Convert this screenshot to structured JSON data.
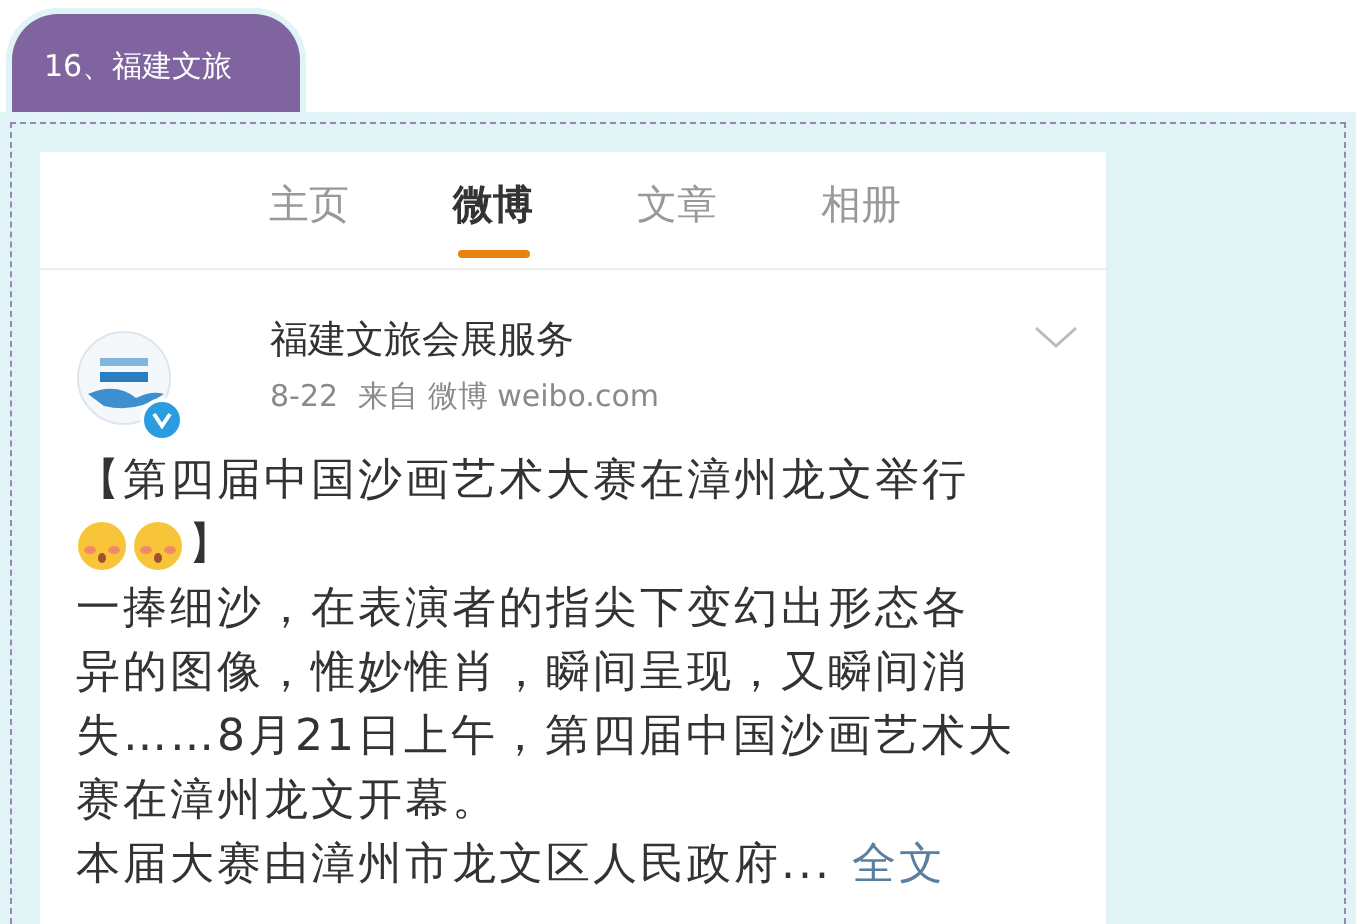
{
  "section_tab": {
    "label": "16、福建文旅"
  },
  "nav_tabs": [
    {
      "label": "主页",
      "selected": false
    },
    {
      "label": "微博",
      "selected": true
    },
    {
      "label": "文章",
      "selected": false
    },
    {
      "label": "相册",
      "selected": false
    }
  ],
  "post": {
    "author": "福建文旅会展服务",
    "verified": true,
    "date": "8-22",
    "source": "来自 微博 weibo.com",
    "title_start": "【第四届中国沙画艺术大赛在漳州龙文举行",
    "title_emojis": [
      {
        "kind": "blush"
      },
      {
        "kind": "blush"
      }
    ],
    "title_end": "】",
    "body_lines": [
      "一捧细沙，在表演者的指尖下变幻出形态各",
      "异的图像，惟妙惟肖，瞬间呈现，又瞬间消",
      "失……8月21日上午，第四届中国沙画艺术大",
      "赛在漳州龙文开幕。"
    ],
    "last_line": "本届大赛由漳州市龙文区人民政府...",
    "more_link": "全文"
  }
}
